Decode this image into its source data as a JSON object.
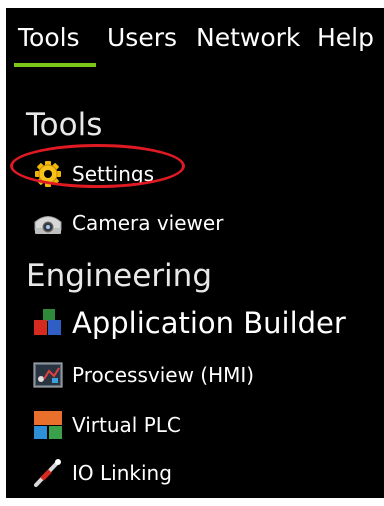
{
  "nav": {
    "tabs": [
      {
        "label": "Tools",
        "active": true
      },
      {
        "label": "Users"
      },
      {
        "label": "Network"
      },
      {
        "label": "Help"
      }
    ],
    "active_color": "#7cc51a"
  },
  "sections": [
    {
      "heading": "Tools",
      "items": [
        {
          "label": "Settings",
          "icon": "gear-icon",
          "highlighted": true
        },
        {
          "label": "Camera viewer",
          "icon": "camera-icon"
        }
      ]
    },
    {
      "heading": "Engineering",
      "items": [
        {
          "label": "Application Builder",
          "icon": "blocks-icon"
        },
        {
          "label": "Processview (HMI)",
          "icon": "hmi-icon"
        },
        {
          "label": "Virtual PLC",
          "icon": "plc-icon"
        },
        {
          "label": "IO Linking",
          "icon": "io-link-icon"
        }
      ]
    }
  ],
  "highlight_color": "#e01a22"
}
